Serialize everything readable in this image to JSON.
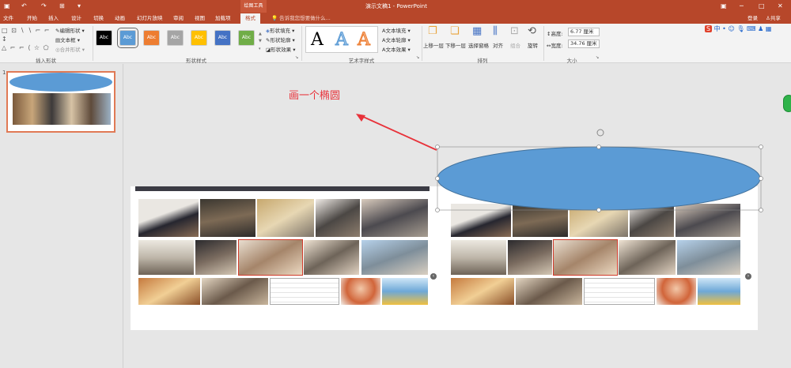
{
  "app": {
    "title": "演示文稿1 - PowerPoint",
    "context_label": "绘图工具",
    "login": "登录",
    "share": "共享"
  },
  "tabs": [
    "文件",
    "开始",
    "插入",
    "设计",
    "切换",
    "动画",
    "幻灯片放映",
    "审阅",
    "视图",
    "加载项",
    "格式"
  ],
  "active_tab": "格式",
  "tell_me": "告诉我您想要做什么...",
  "ribbon": {
    "insert_shapes": {
      "label": "插入形状",
      "edit_shape": "编辑形状",
      "textbox": "文本框",
      "merge": "合并形状"
    },
    "shape_styles": {
      "label": "形状样式",
      "swatch_text": "Abc",
      "swatches": [
        "#000000",
        "#5b9bd5",
        "#ed7d31",
        "#a5a5a5",
        "#ffc000",
        "#4472c4",
        "#70ad47"
      ],
      "fill": "形状填充",
      "outline": "形状轮廓",
      "effects": "形状效果"
    },
    "wordart": {
      "label": "艺术字样式",
      "letter": "A",
      "colors": [
        "#000000",
        "#5b9bd5",
        "#ed7d31"
      ],
      "text_fill": "文本填充",
      "text_outline": "文本轮廓",
      "text_effects": "文本效果"
    },
    "arrange": {
      "label": "排列",
      "bring_forward": "上移一层",
      "send_backward": "下移一层",
      "selection_pane": "选择窗格",
      "align": "对齐",
      "group": "组合",
      "rotate": "旋转"
    },
    "size": {
      "label": "大小",
      "height_label": "高度:",
      "height": "6.77 厘米",
      "width_label": "宽度:",
      "width": "34.76 厘米"
    }
  },
  "slides": {
    "number": "1"
  },
  "annotation": "画一个椭圆",
  "colors": {
    "accent": "#b7472a",
    "ellipse": "#5b9bd5",
    "arrow": "#e8323a"
  }
}
